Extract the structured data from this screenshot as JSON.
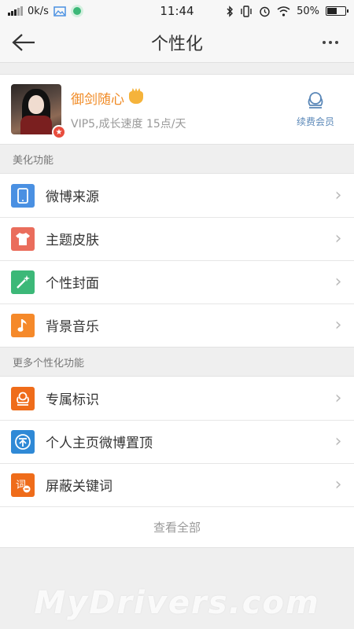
{
  "status_bar": {
    "network_speed": "0k/s",
    "time": "11:44",
    "battery": "50%"
  },
  "header": {
    "title": "个性化"
  },
  "profile": {
    "name": "御剑随心",
    "subtitle": "VIP5,成长速度 15点/天",
    "renew_label": "续费会员"
  },
  "sections": [
    {
      "label": "美化功能",
      "items": [
        {
          "label": "微博来源",
          "icon": "phone-icon",
          "color": "#4a90e2"
        },
        {
          "label": "主题皮肤",
          "icon": "shirt-icon",
          "color": "#ea6d5c"
        },
        {
          "label": "个性封面",
          "icon": "magic-wand-icon",
          "color": "#3cb878"
        },
        {
          "label": "背景音乐",
          "icon": "music-note-icon",
          "color": "#f5892a"
        }
      ]
    },
    {
      "label": "更多个性化功能",
      "items": [
        {
          "label": "专属标识",
          "icon": "crown-icon",
          "color": "#ef6c1a"
        },
        {
          "label": "个人主页微博置顶",
          "icon": "pin-top-icon",
          "color": "#2f89d6"
        },
        {
          "label": "屏蔽关键词",
          "icon": "keyword-block-icon",
          "color": "#ef6c1a"
        }
      ]
    }
  ],
  "view_all": "查看全部",
  "watermark": "MyDrivers.com"
}
